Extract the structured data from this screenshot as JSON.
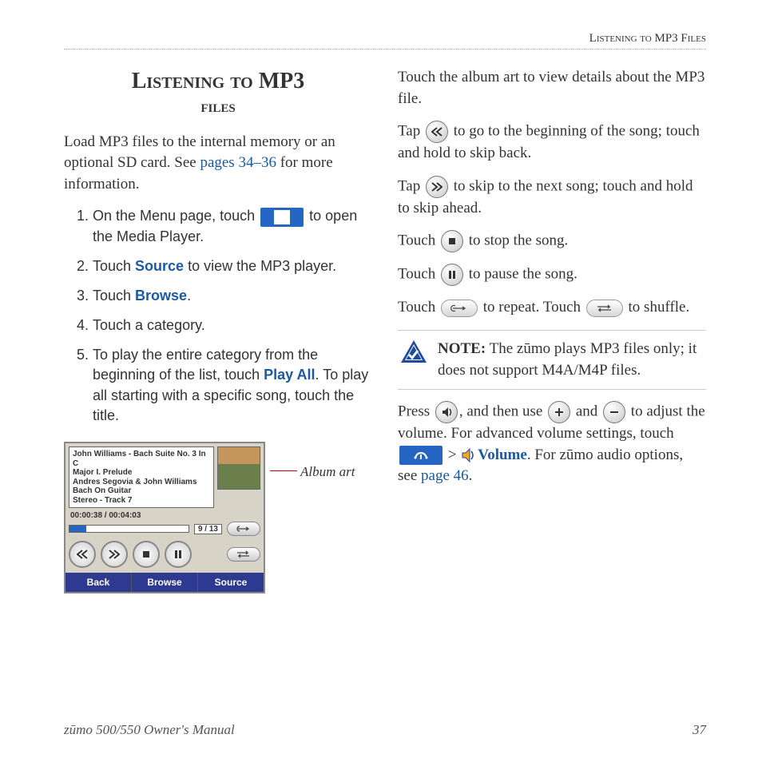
{
  "running_header": "Listening to MP3 Files",
  "title_line1": "Listening to MP3",
  "title_line2": "files",
  "intro_a": "Load MP3 files to the internal memory or an optional SD card. See ",
  "intro_link": "pages 34–36",
  "intro_b": " for more information.",
  "steps": {
    "1a": "On the Menu page, touch ",
    "1b": " to open the Media Player.",
    "2a": "Touch ",
    "2_source": "Source",
    "2b": " to view the MP3 player.",
    "3a": "Touch ",
    "3_browse": "Browse",
    "3b": ".",
    "4": "Touch a category.",
    "5a": "To play the entire category from the beginning of the list, touch ",
    "5_playall": "Play All",
    "5b": ". To play all starting with a specific song, touch the title."
  },
  "player": {
    "line1": "John Williams - Bach Suite No. 3 In C",
    "line2": "Major I. Prelude",
    "line3": "Andres Segovia & John Williams",
    "line4": "Bach On Guitar",
    "line5": "Stereo - Track 7",
    "time": "00:00:38 / 00:04:03",
    "count": "9 / 13",
    "back": "Back",
    "browse": "Browse",
    "source": "Source"
  },
  "callout_album_art": "Album art",
  "right": {
    "p1": "Touch the album art to view details about the MP3 file.",
    "p2a": "Tap ",
    "p2b": " to go to the beginning of the song; touch and hold to skip back.",
    "p3a": "Tap ",
    "p3b": " to skip to the next song; touch and hold to skip ahead.",
    "p4a": "Touch ",
    "p4b": " to stop the song.",
    "p5a": "Touch ",
    "p5b": " to pause the song.",
    "p6a": "Touch ",
    "p6b": " to repeat. Touch ",
    "p6c": " to shuffle.",
    "note_label": "NOTE:",
    "note_body": " The zūmo plays MP3 files only; it does not support M4A/M4P files.",
    "p7a": "Press ",
    "p7b": ", and then use ",
    "p7c": " and ",
    "p7d": " to adjust the volume. For advanced volume settings, touch ",
    "p7e": " > ",
    "p7_volume": "Volume",
    "p7f": ". For zūmo audio options, see ",
    "p7_link": "page 46",
    "p7g": "."
  },
  "footer_left": "zūmo 500/550 Owner's Manual",
  "footer_right": "37"
}
